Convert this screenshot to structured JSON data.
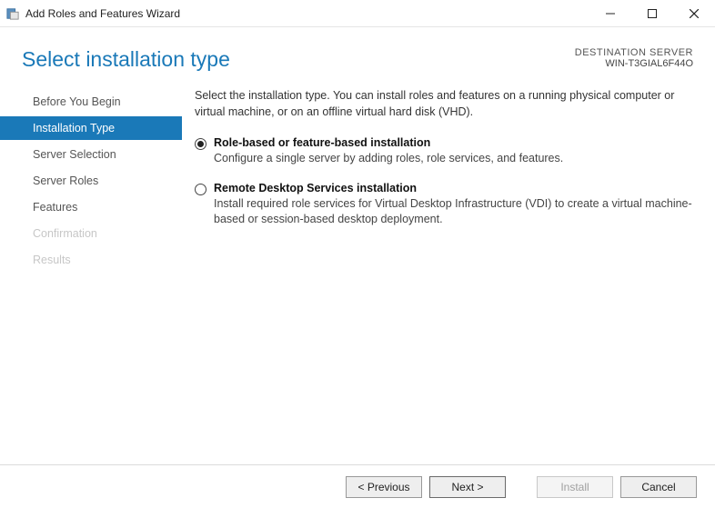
{
  "window": {
    "title": "Add Roles and Features Wizard"
  },
  "header": {
    "page_title": "Select installation type",
    "dest_label": "DESTINATION SERVER",
    "dest_server": "WIN-T3GIAL6F44O"
  },
  "sidebar": {
    "items": [
      {
        "label": "Before You Begin",
        "state": "normal"
      },
      {
        "label": "Installation Type",
        "state": "selected"
      },
      {
        "label": "Server Selection",
        "state": "normal"
      },
      {
        "label": "Server Roles",
        "state": "normal"
      },
      {
        "label": "Features",
        "state": "normal"
      },
      {
        "label": "Confirmation",
        "state": "disabled"
      },
      {
        "label": "Results",
        "state": "disabled"
      }
    ]
  },
  "content": {
    "intro": "Select the installation type. You can install roles and features on a running physical computer or virtual machine, or on an offline virtual hard disk (VHD).",
    "options": [
      {
        "title": "Role-based or feature-based installation",
        "desc": "Configure a single server by adding roles, role services, and features.",
        "selected": true
      },
      {
        "title": "Remote Desktop Services installation",
        "desc": "Install required role services for Virtual Desktop Infrastructure (VDI) to create a virtual machine-based or session-based desktop deployment.",
        "selected": false
      }
    ]
  },
  "footer": {
    "previous": "< Previous",
    "next": "Next >",
    "install": "Install",
    "cancel": "Cancel"
  }
}
